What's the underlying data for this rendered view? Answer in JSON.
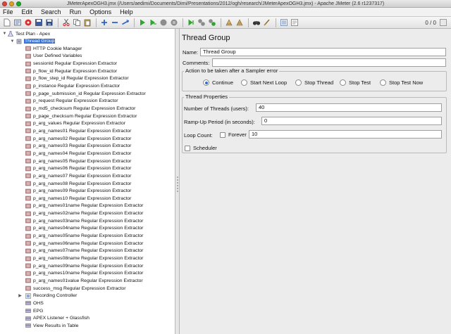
{
  "window": {
    "title": "JMeterApexOGH3.jmx (/Users/aedimi/Documents/Dimi/Presentations/2012/ogh/research/JMeterApexOGH3.jmx) - Apache JMeter (2.6 r1237317)"
  },
  "menu": [
    "File",
    "Edit",
    "Search",
    "Run",
    "Options",
    "Help"
  ],
  "toolbar": {
    "icons": [
      "new-icon",
      "templates-icon",
      "open-icon",
      "close-icon",
      "save-icon",
      "save-as-icon",
      "cut-icon",
      "copy-icon",
      "paste-icon",
      "expand-icon",
      "collapse-icon",
      "toggle-icon",
      "start-icon",
      "start-no-pauses-icon",
      "stop-icon",
      "shutdown-icon",
      "remote-start-icon",
      "remote-stop-icon",
      "remote-exit-icon",
      "clear-icon",
      "clear-all-icon",
      "search-icon",
      "reset-search-icon",
      "function-helper-icon",
      "help-icon"
    ],
    "active_threads": "0 / 0",
    "colors": {
      "green": "#2fa62f",
      "red": "#cc2b2b",
      "blue": "#2f62c9",
      "gray": "#8c8c8c"
    }
  },
  "tree": {
    "root": "Test Plan - Apex",
    "thread_group": "Thread Group",
    "items": [
      "HTTP Cookie Manager",
      "User Defined Variables",
      "sessionId Regular Expression Extractor",
      "p_flow_id Regular Expression Extractor",
      "p_flow_step_id Regular Expression Extractor",
      "p_instance Regular Expression Extractor",
      "p_page_submission_id Regular Expression Extractor",
      "p_request Regular Expression Extractor",
      "p_md5_checksum Regular Expression Extractor",
      "p_page_checksum Regular Expression Extractor",
      "p_arg_values Regular Expression Extractor",
      "p_arg_names01 Regular Expression Extractor",
      "p_arg_names02 Regular Expression Extractor",
      "p_arg_names03 Regular Expression Extractor",
      "p_arg_names04 Regular Expression Extractor",
      "p_arg_names05 Regular Expression Extractor",
      "p_arg_names06 Regular Expression Extractor",
      "p_arg_names07 Regular Expression Extractor",
      "p_arg_names08 Regular Expression Extractor",
      "p_arg_names09 Regular Expression Extractor",
      "p_arg_names10 Regular Expression Extractor",
      "p_arg_names01name Regular Expression Extractor",
      "p_arg_names02name Regular Expression Extractor",
      "p_arg_names03name Regular Expression Extractor",
      "p_arg_names04name Regular Expression Extractor",
      "p_arg_names05name Regular Expression Extractor",
      "p_arg_names06name Regular Expression Extractor",
      "p_arg_names07name Regular Expression Extractor",
      "p_arg_names08name Regular Expression Extractor",
      "p_arg_names09name Regular Expression Extractor",
      "p_arg_names10name Regular Expression Extractor",
      "p_arg_names01value Regular Expression Extractor",
      "success_msg Regular Expression Extractor"
    ],
    "bottom_items": [
      "Recording Controller",
      "OHS",
      "EPG",
      "APEX Listener + Glassfish",
      "View Results in Table"
    ]
  },
  "panel": {
    "title": "Thread Group",
    "name_label": "Name:",
    "name_value": "Thread Group",
    "comments_label": "Comments:",
    "comments_value": "",
    "error_group_title": "Action to be taken after a Sampler error",
    "error_actions": [
      "Continue",
      "Start Next Loop",
      "Stop Thread",
      "Stop Test",
      "Stop Test Now"
    ],
    "error_selected": "Continue",
    "props_title": "Thread Properties",
    "threads_label": "Number of Threads (users):",
    "threads_value": "40",
    "rampup_label": "Ramp-Up Period (in seconds):",
    "rampup_value": "0",
    "loop_label": "Loop Count:",
    "forever_label": "Forever",
    "loop_value": "10",
    "scheduler_label": "Scheduler"
  }
}
